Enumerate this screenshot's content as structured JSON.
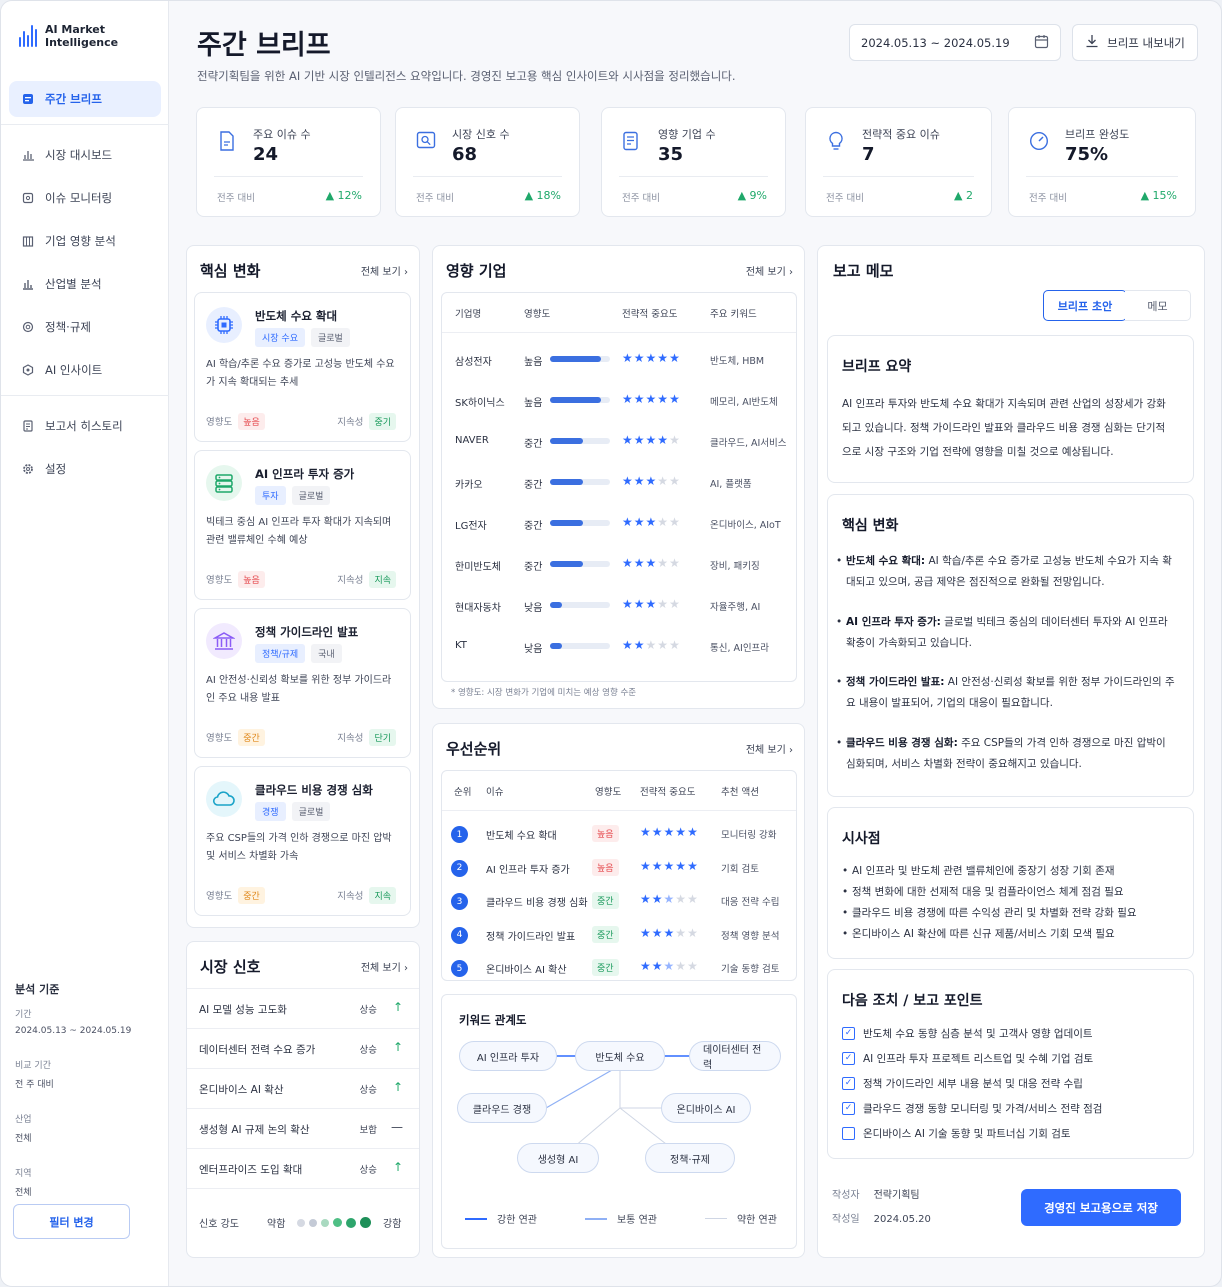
{
  "app": {
    "logo_line1": "AI Market",
    "logo_line2": "Intelligence"
  },
  "sidebar": {
    "items": [
      {
        "label": "주간 브리프",
        "icon": "brief-icon"
      },
      {
        "label": "시장 대시보드",
        "icon": "chart-icon"
      },
      {
        "label": "이슈 모니터링",
        "icon": "monitor-icon"
      },
      {
        "label": "기업 영향 분석",
        "icon": "building-icon"
      },
      {
        "label": "산업별 분석",
        "icon": "bar-icon"
      },
      {
        "label": "정책·규제",
        "icon": "policy-icon"
      },
      {
        "label": "AI 인사이트",
        "icon": "ai-icon"
      },
      {
        "label": "보고서 히스토리",
        "icon": "history-icon"
      },
      {
        "label": "설정",
        "icon": "gear-icon"
      }
    ],
    "criteria": {
      "title": "분석 기준",
      "period_label": "기간",
      "period": "2024.05.13 ~ 2024.05.19",
      "compare_label": "비교 기간",
      "compare": "전 주 대비",
      "industry_label": "산업",
      "industry": "전체",
      "region_label": "지역",
      "region": "전체"
    },
    "filter_button": "필터 변경"
  },
  "header": {
    "title": "주간 브리프",
    "subtitle": "전략기획팀을 위한 AI 기반 시장 인텔리전스 요약입니다. 경영진 보고용 핵심 인사이트와 시사점을 정리했습니다.",
    "date_range": "2024.05.13 ~ 2024.05.19",
    "export": "브리프 내보내기"
  },
  "stats": [
    {
      "label": "주요 이슈 수",
      "value": "24",
      "compare": "전주 대비",
      "change": "▲ 12%"
    },
    {
      "label": "시장 신호 수",
      "value": "68",
      "compare": "전주 대비",
      "change": "▲ 18%"
    },
    {
      "label": "영향 기업 수",
      "value": "35",
      "compare": "전주 대비",
      "change": "▲ 9%"
    },
    {
      "label": "전략적 중요 이슈",
      "value": "7",
      "compare": "전주 대비",
      "change": "▲ 2"
    },
    {
      "label": "브리프 완성도",
      "value": "75%",
      "compare": "전주 대비",
      "change": "▲ 15%"
    }
  ],
  "changes": {
    "title": "핵심 변화",
    "more": "전체 보기 ›",
    "cards": [
      {
        "title": "반도체 수요 확대",
        "tag1": "시장 수요",
        "tag2": "글로벌",
        "desc": "AI 학습/추론 수요 증가로 고성능 반도체 수요가 지속 확대되는 추세",
        "impact_label": "영향도",
        "impact": "높음",
        "dur_label": "지속성",
        "dur": "중기"
      },
      {
        "title": "AI 인프라 투자 증가",
        "tag1": "투자",
        "tag2": "글로벌",
        "desc": "빅테크 중심 AI 인프라 투자 확대가 지속되며 관련 밸류체인 수혜 예상",
        "impact_label": "영향도",
        "impact": "높음",
        "dur_label": "지속성",
        "dur": "지속"
      },
      {
        "title": "정책 가이드라인 발표",
        "tag1": "정책/규제",
        "tag2": "국내",
        "desc": "AI 안전성·신뢰성 확보를 위한 정부 가이드라인 주요 내용 발표",
        "impact_label": "영향도",
        "impact": "중간",
        "dur_label": "지속성",
        "dur": "단기"
      },
      {
        "title": "클라우드 비용 경쟁 심화",
        "tag1": "경쟁",
        "tag2": "글로벌",
        "desc": "주요 CSP들의 가격 인하 경쟁으로 마진 압박 및 서비스 차별화 가속",
        "impact_label": "영향도",
        "impact": "중간",
        "dur_label": "지속성",
        "dur": "지속"
      }
    ]
  },
  "signals": {
    "title": "시장 신호",
    "more": "전체 보기 ›",
    "rows": [
      {
        "name": "AI 모델 성능 고도화",
        "dir": "상승",
        "arrow": "↑"
      },
      {
        "name": "데이터센터 전력 수요 증가",
        "dir": "상승",
        "arrow": "↑"
      },
      {
        "name": "온디바이스 AI 확산",
        "dir": "상승",
        "arrow": "↑"
      },
      {
        "name": "생성형 AI 규제 논의 확산",
        "dir": "보합",
        "arrow": "—"
      },
      {
        "name": "엔터프라이즈 도입 확대",
        "dir": "상승",
        "arrow": "↑"
      }
    ],
    "strength_label": "신호 강도",
    "weak": "약함",
    "strong": "강함"
  },
  "companies": {
    "title": "영향 기업",
    "more": "전체 보기 ›",
    "headers": [
      "기업명",
      "영향도",
      "전략적 중요도",
      "주요 키워드"
    ],
    "rows": [
      {
        "name": "삼성전자",
        "impact": "높음",
        "level": 0.85,
        "stars": 5,
        "kw": "반도체, HBM"
      },
      {
        "name": "SK하이닉스",
        "impact": "높음",
        "level": 0.85,
        "stars": 5,
        "kw": "메모리, AI반도체"
      },
      {
        "name": "NAVER",
        "impact": "중간",
        "level": 0.55,
        "stars": 4,
        "kw": "클라우드, AI서비스"
      },
      {
        "name": "카카오",
        "impact": "중간",
        "level": 0.55,
        "stars": 3,
        "kw": "AI, 플랫폼"
      },
      {
        "name": "LG전자",
        "impact": "중간",
        "level": 0.55,
        "stars": 3,
        "kw": "온디바이스, AIoT"
      },
      {
        "name": "한미반도체",
        "impact": "중간",
        "level": 0.55,
        "stars": 3,
        "kw": "장비, 패키징"
      },
      {
        "name": "현대자동차",
        "impact": "낮음",
        "level": 0.2,
        "stars": 3,
        "kw": "자율주행, AI"
      },
      {
        "name": "KT",
        "impact": "낮음",
        "level": 0.2,
        "stars": 2,
        "kw": "통신, AI인프라"
      }
    ],
    "note": "* 영향도: 시장 변화가 기업에 미치는 예상 영향 수준"
  },
  "priority": {
    "title": "우선순위",
    "more": "전체 보기 ›",
    "headers": [
      "순위",
      "이슈",
      "영향도",
      "전략적 중요도",
      "추천 액션"
    ],
    "rows": [
      {
        "rank": "1",
        "issue": "반도체 수요 확대",
        "impact": "높음",
        "stars": 5,
        "action": "모니터링 강화"
      },
      {
        "rank": "2",
        "issue": "AI 인프라 투자 증가",
        "impact": "높음",
        "stars": 5,
        "action": "기회 검토"
      },
      {
        "rank": "3",
        "issue": "클라우드 비용 경쟁 심화",
        "impact": "중간",
        "stars": 2.5,
        "action": "대응 전략 수립"
      },
      {
        "rank": "4",
        "issue": "정책 가이드라인 발표",
        "impact": "중간",
        "stars": 3,
        "action": "정책 영향 분석"
      },
      {
        "rank": "5",
        "issue": "온디바이스 AI 확산",
        "impact": "중간",
        "stars": 2.5,
        "action": "기술 동향 검토"
      }
    ]
  },
  "keywords": {
    "title": "키워드 관계도",
    "nodes": [
      "AI 인프라 투자",
      "반도체 수요",
      "데이터센터 전력",
      "클라우드 경쟁",
      "온디바이스 AI",
      "생성형 AI",
      "정책·규제"
    ],
    "legend": [
      "강한 연관",
      "보통 연관",
      "약한 연관"
    ],
    "colors": {
      "strong": "#2f6bff",
      "medium": "#8fb0f5",
      "weak": "#cfd6e4"
    }
  },
  "memo": {
    "title": "보고 메모",
    "tab_draft": "브리프 초안",
    "tab_memo": "메모",
    "summary_title": "브리프 요약",
    "summary": "AI 인프라 투자와 반도체 수요 확대가 지속되며 관련 산업의 성장세가 강화되고 있습니다. 정책 가이드라인 발표와 클라우드 비용 경쟁 심화는 단기적으로 시장 구조와 기업 전략에 영향을 미칠 것으로 예상됩니다.",
    "changes_title": "핵심 변화",
    "changes": [
      {
        "head": "반도체 수요 확대:",
        "text": "AI 학습/추론 수요 증가로 고성능 반도체 수요가 지속 확대되고 있으며, 공급 제약은 점진적으로 완화될 전망입니다."
      },
      {
        "head": "AI 인프라 투자 증가:",
        "text": "글로벌 빅테크 중심의 데이터센터 투자와 AI 인프라 확충이 가속화되고 있습니다."
      },
      {
        "head": "정책 가이드라인 발표:",
        "text": "AI 안전성·신뢰성 확보를 위한 정부 가이드라인의 주요 내용이 발표되어, 기업의 대응이 필요합니다."
      },
      {
        "head": "클라우드 비용 경쟁 심화:",
        "text": "주요 CSP들의 가격 인하 경쟁으로 마진 압박이 심화되며, 서비스 차별화 전략이 중요해지고 있습니다."
      }
    ],
    "implications_title": "시사점",
    "implications": [
      "AI 인프라 및 반도체 관련 밸류체인에 중장기 성장 기회 존재",
      "정책 변화에 대한 선제적 대응 및 컴플라이언스 체계 점검 필요",
      "클라우드 비용 경쟁에 따른 수익성 관리 및 차별화 전략 강화 필요",
      "온디바이스 AI 확산에 따른 신규 제품/서비스 기회 모색 필요"
    ],
    "actions_title": "다음 조치 / 보고 포인트",
    "actions": [
      {
        "text": "반도체 수요 동향 심층 분석 및 고객사 영향 업데이트",
        "checked": true
      },
      {
        "text": "AI 인프라 투자 프로젝트 리스트업 및 수혜 기업 검토",
        "checked": true
      },
      {
        "text": "정책 가이드라인 세부 내용 분석 및 대응 전략 수립",
        "checked": true
      },
      {
        "text": "클라우드 경쟁 동향 모니터링 및 가격/서비스 전략 점검",
        "checked": true
      },
      {
        "text": "온디바이스 AI 기술 동향 및 파트너십 기회 검토",
        "checked": false
      }
    ],
    "author_label": "작성자",
    "author": "전략기획팀",
    "date_label": "작성일",
    "date": "2024.05.20",
    "save": "경영진 보고용으로 저장"
  }
}
